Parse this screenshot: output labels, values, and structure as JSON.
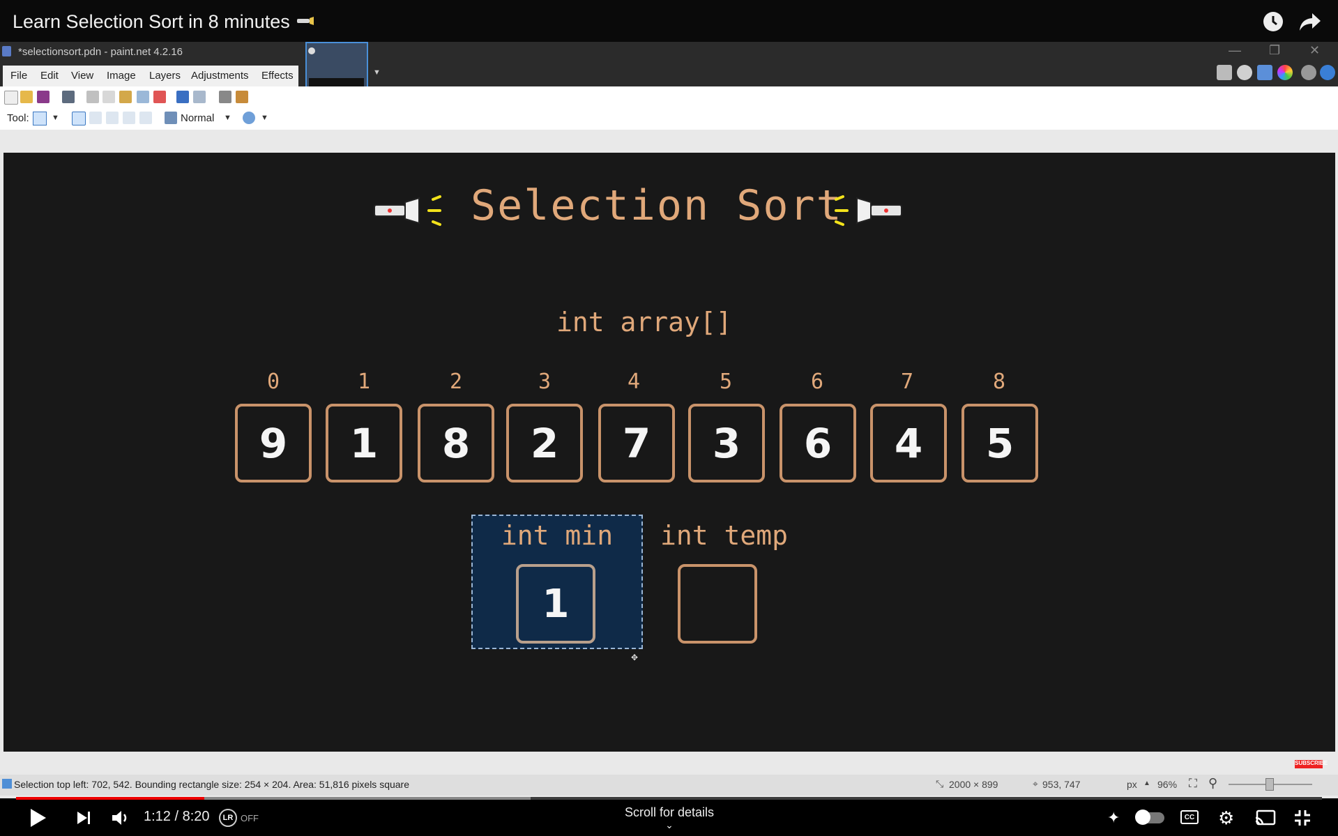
{
  "youtube": {
    "video_title": "Learn Selection Sort in 8 minutes",
    "title_emoji": "flashlight-emoji",
    "time_current": "1:12",
    "time_separator": "/",
    "time_total": "8:20",
    "time_display": "1:12 / 8:20",
    "lr_badge": "LR",
    "lr_state": "OFF",
    "scroll_hint": "Scroll for details",
    "progress_played_fraction": 0.144,
    "progress_buffered_fraction": 0.394,
    "subscribe_badge": "SUBSCRIBE"
  },
  "paintnet": {
    "window_title": "*selectionsort.pdn - paint.net 4.2.16",
    "menu": [
      "File",
      "Edit",
      "View",
      "Image",
      "Layers",
      "Adjustments",
      "Effects"
    ],
    "tool_label": "Tool:",
    "blend_mode": "Normal",
    "status_text": "Selection top left: 702, 542. Bounding rectangle size: 254 × 204. Area: 51,816 pixels square",
    "image_size": "2000 × 899",
    "cursor_position": "953, 747",
    "units": "px",
    "zoom": "96%"
  },
  "canvas": {
    "title": "Selection Sort",
    "array_label": "int array[]",
    "indices": [
      "0",
      "1",
      "2",
      "3",
      "4",
      "5",
      "6",
      "7",
      "8"
    ],
    "values": [
      "9",
      "1",
      "8",
      "2",
      "7",
      "3",
      "6",
      "4",
      "5"
    ],
    "min_label": "int min",
    "min_value": "1",
    "temp_label": "int temp",
    "temp_value": ""
  },
  "colors": {
    "accent_text": "#e0a87a",
    "cell_border": "#c9936a",
    "selection_fill": "#0f2a48",
    "progress_red": "#ee0000"
  }
}
